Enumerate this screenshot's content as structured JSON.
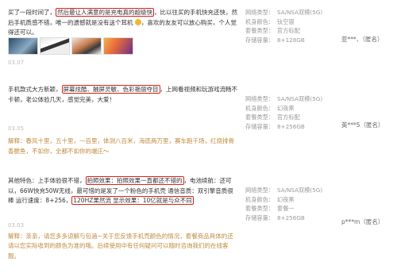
{
  "reviews": [
    {
      "text_a": "买了一段时间了，",
      "text_hl": "然后最让人满意的是充电真的超级快",
      "text_b": "，比以往买的手机快充还快，然后手机质感不错，唯一的遗憾就是没有送个耳机",
      "text_c": "，喜欢的友友可以放心购买，个人觉得还可以。",
      "date": "03.07",
      "specs": [
        {
          "k": "网络类型：",
          "v": "SA/NSA双模(5G)"
        },
        {
          "k": "机身颜色：",
          "v": "钛空银"
        },
        {
          "k": "套餐类型：",
          "v": "官方标配"
        },
        {
          "k": "存储容量：",
          "v": "8+128GB"
        }
      ],
      "user": "亚***、（匿名）"
    },
    {
      "text_a": "手机款式大方新颖，",
      "text_hl": "屏幕炫酷、触屏灵敏、色彩艳丽夺目",
      "text_b": "，上网看视频和玩游戏流畅不卡顿，老公体验几天，感觉完美，大爱！",
      "date": "03.05",
      "reply": "解释：春风十里，五十里，一百里，体测八百米，海底两万里，赛车跑千场，红烧排骨香脆鱼，不如你，全都不如你的端庄～",
      "specs": [
        {
          "k": "网络类型：",
          "v": "SA/NSA双模(5G)"
        },
        {
          "k": "机身颜色：",
          "v": "幻夜黑"
        },
        {
          "k": "套餐类型：",
          "v": "官方标配"
        },
        {
          "k": "存储容量：",
          "v": "8+256GB"
        }
      ],
      "user": "英***5（匿名）"
    },
    {
      "text_a": "其他特色：上手体验很不错，",
      "text_hl": "拍照效果：拍照效果一直都还不错的",
      "text_b": "，电池续航：还可以，66W快充50W无线，最可惜的是发了一个粉色的手机壳 通信音质：双引擎音质很棒 运行速度：8+256，",
      "text_hl2": "120HZ果然流 显示效果：10亿就是与众不同",
      "date": "03.03",
      "reply": "解释：亲亲，请您多多谅解与包涵~关于您反馈手机壳颜色的情况，套餐商品具体的还请以您实际收到的颜色为准的哦。后续使用中有任何疑问可以随时咨询我们的在线客服。",
      "specs": [
        {
          "k": "网络类型：",
          "v": "SA/NSA双模(5G)"
        },
        {
          "k": "机身颜色：",
          "v": "幻夜黑"
        },
        {
          "k": "套餐类型：",
          "v": "套餐一"
        },
        {
          "k": "存储容量：",
          "v": "8+256GB"
        }
      ],
      "user": "p***m（匿名）"
    }
  ]
}
